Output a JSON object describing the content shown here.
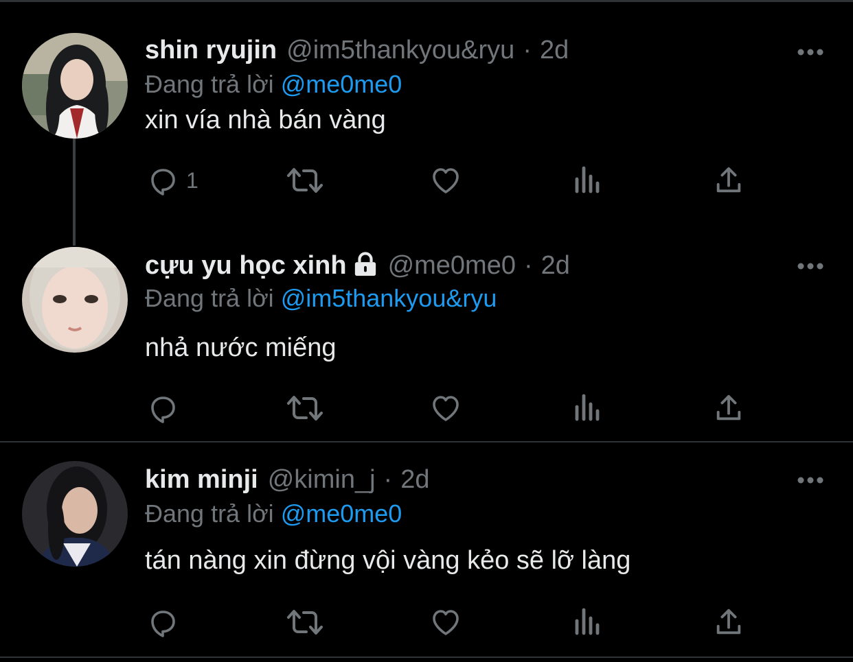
{
  "tweets": [
    {
      "name": "shin ryujin",
      "handle": "@im5thankyou&ryu",
      "dot": "·",
      "time": "2d",
      "reply_prefix": "Đang trả lời",
      "reply_to": "@me0me0",
      "text": "xin vía nhà bán vàng",
      "reply_count": "1",
      "locked": false,
      "avatar_icon": "avatar-ryujin"
    },
    {
      "name": "cựu yu học xinh",
      "handle": "@me0me0",
      "dot": "·",
      "time": "2d",
      "reply_prefix": "Đang trả lời",
      "reply_to": "@im5thankyou&ryu",
      "text": "nhả nước miếng",
      "reply_count": "",
      "locked": true,
      "avatar_icon": "avatar-yu"
    },
    {
      "name": "kim minji",
      "handle": "@kimin_j",
      "dot": "·",
      "time": "2d",
      "reply_prefix": "Đang trả lời",
      "reply_to": "@me0me0",
      "text": "tán nàng xin đừng vội vàng kẻo sẽ lỡ làng",
      "reply_count": "",
      "locked": false,
      "avatar_icon": "avatar-minji"
    }
  ],
  "icons": [
    "reply-icon",
    "retweet-icon",
    "like-icon",
    "views-icon",
    "share-icon",
    "more-icon",
    "lock-icon"
  ],
  "colors": {
    "background": "#000000",
    "text": "#e7e9ea",
    "muted": "#71767b",
    "mention": "#1d9bf0",
    "divider": "#2f3336"
  }
}
